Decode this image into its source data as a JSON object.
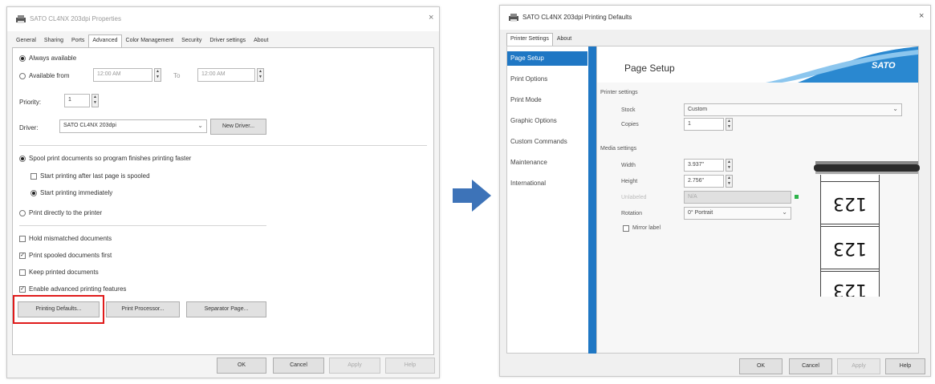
{
  "left_dialog": {
    "title": "SATO CL4NX 203dpi Properties",
    "close_glyph": "×",
    "tabs": [
      "General",
      "Sharing",
      "Ports",
      "Advanced",
      "Color Management",
      "Security",
      "Driver settings",
      "About"
    ],
    "active_tab": "Advanced",
    "always_available": "Always available",
    "available_from": "Available from",
    "from_time": "12:00 AM",
    "to_label": "To",
    "to_time": "12:00 AM",
    "priority_label": "Priority:",
    "priority_value": "1",
    "driver_label": "Driver:",
    "driver_value": "SATO CL4NX 203dpi",
    "new_driver": "New Driver...",
    "spool": "Spool print documents so program finishes printing faster",
    "start_after_last": "Start printing after last page is spooled",
    "start_immediately": "Start printing immediately",
    "print_directly": "Print directly to the printer",
    "hold_mismatched": "Hold mismatched documents",
    "print_spooled_first": "Print spooled documents first",
    "keep_printed": "Keep printed documents",
    "enable_advanced": "Enable advanced printing features",
    "printing_defaults": "Printing Defaults...",
    "print_processor": "Print Processor...",
    "separator_page": "Separator Page...",
    "ok": "OK",
    "cancel": "Cancel",
    "apply": "Apply",
    "help": "Help"
  },
  "right_dialog": {
    "title": "SATO CL4NX 203dpi Printing Defaults",
    "close_glyph": "×",
    "tabs": [
      "Printer Settings",
      "About"
    ],
    "sidebar": [
      "Page Setup",
      "Print Options",
      "Print Mode",
      "Graphic Options",
      "Custom Commands",
      "Maintenance",
      "International"
    ],
    "heading": "Page Setup",
    "logo": "SATO",
    "printer_settings": "Printer settings",
    "stock_label": "Stock",
    "stock_value": "Custom",
    "copies_label": "Copies",
    "copies_value": "1",
    "media_settings": "Media settings",
    "width_label": "Width",
    "width_value": "3.937\"",
    "height_label": "Height",
    "height_value": "2.756\"",
    "unlabeled_label": "Unlabeled",
    "unlabeled_value": "N/A",
    "rotation_label": "Rotation",
    "rotation_value": "0° Portrait",
    "mirror_label": "Mirror label",
    "preview_text": "123",
    "ok": "OK",
    "cancel": "Cancel",
    "apply": "Apply",
    "help": "Help"
  },
  "colors": {
    "accent": "#1f77c4",
    "highlight": "#e01b1b",
    "arrow": "#3d73b8"
  }
}
